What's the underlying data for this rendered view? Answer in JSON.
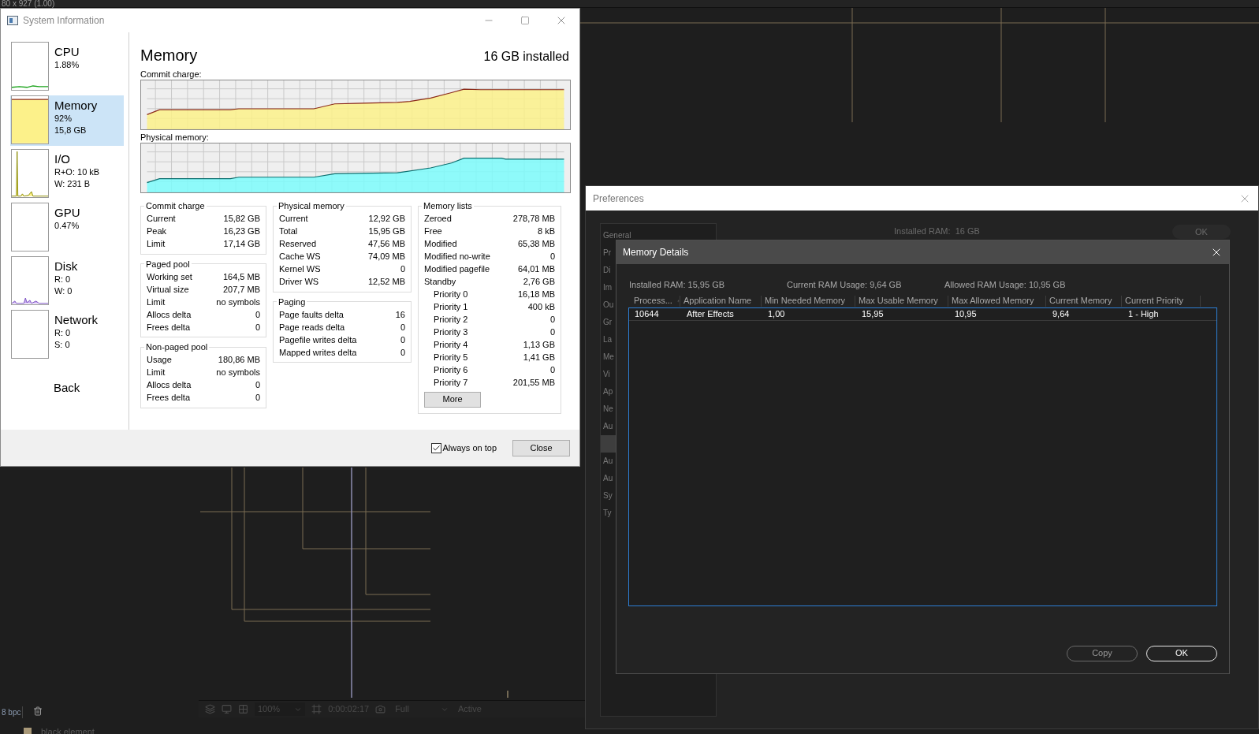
{
  "editor": {
    "resolution_label": "80 x 927 (1.00)",
    "bit_depth": "8 bpc",
    "layer_name": "black element",
    "viewer_toolbar": {
      "zoom": "100%",
      "timecode": "0:00:02:17",
      "resolution": "Full",
      "view": "Active"
    }
  },
  "system_info": {
    "title": "System Information",
    "sidebar": [
      {
        "title": "CPU",
        "lines": [
          "1.88%"
        ],
        "kind": "cpu",
        "selected": false
      },
      {
        "title": "Memory",
        "lines": [
          "92%",
          "15,8 GB"
        ],
        "kind": "memory",
        "selected": true
      },
      {
        "title": "I/O",
        "lines": [
          "R+O: 10 kB",
          "W: 231 B"
        ],
        "kind": "io",
        "selected": false
      },
      {
        "title": "GPU",
        "lines": [
          "0.47%"
        ],
        "kind": "empty",
        "selected": false
      },
      {
        "title": "Disk",
        "lines": [
          "R: 0",
          "W: 0"
        ],
        "kind": "disk",
        "selected": false
      },
      {
        "title": "Network",
        "lines": [
          "R: 0",
          "S: 0"
        ],
        "kind": "empty",
        "selected": false
      }
    ],
    "back": "Back",
    "heading": "Memory",
    "installed": "16 GB installed",
    "graphs": [
      {
        "label": "Commit charge:",
        "kind": "commit"
      },
      {
        "label": "Physical memory:",
        "kind": "physical"
      }
    ],
    "columns": [
      [
        {
          "title": "Commit charge",
          "rows": [
            {
              "label": "Current",
              "value": "15,82 GB"
            },
            {
              "label": "Peak",
              "value": "16,23 GB"
            },
            {
              "label": "Limit",
              "value": "17,14 GB"
            }
          ]
        },
        {
          "title": "Paged pool",
          "rows": [
            {
              "label": "Working set",
              "value": "164,5 MB"
            },
            {
              "label": "Virtual size",
              "value": "207,7 MB"
            },
            {
              "label": "Limit",
              "value": "no symbols"
            },
            {
              "label": "Allocs delta",
              "value": "0"
            },
            {
              "label": "Frees delta",
              "value": "0"
            }
          ]
        },
        {
          "title": "Non-paged pool",
          "rows": [
            {
              "label": "Usage",
              "value": "180,86 MB"
            },
            {
              "label": "Limit",
              "value": "no symbols"
            },
            {
              "label": "Allocs delta",
              "value": "0"
            },
            {
              "label": "Frees delta",
              "value": "0"
            }
          ]
        }
      ],
      [
        {
          "title": "Physical memory",
          "rows": [
            {
              "label": "Current",
              "value": "12,92 GB"
            },
            {
              "label": "Total",
              "value": "15,95 GB"
            },
            {
              "label": "Reserved",
              "value": "47,56 MB"
            },
            {
              "label": "Cache WS",
              "value": "74,09 MB"
            },
            {
              "label": "Kernel WS",
              "value": "0"
            },
            {
              "label": "Driver WS",
              "value": "12,52 MB"
            }
          ]
        },
        {
          "title": "Paging",
          "rows": [
            {
              "label": "Page faults delta",
              "value": "16"
            },
            {
              "label": "Page reads delta",
              "value": "0"
            },
            {
              "label": "Pagefile writes delta",
              "value": "0"
            },
            {
              "label": "Mapped writes delta",
              "value": "0"
            }
          ]
        }
      ],
      [
        {
          "title": "Memory lists",
          "button": "More",
          "rows": [
            {
              "label": "Zeroed",
              "value": "278,78 MB"
            },
            {
              "label": "Free",
              "value": "8 kB"
            },
            {
              "label": "Modified",
              "value": "65,38 MB"
            },
            {
              "label": "Modified no-write",
              "value": "0"
            },
            {
              "label": "Modified pagefile",
              "value": "64,01 MB"
            },
            {
              "label": "Standby",
              "value": "2,76 GB",
              "children": [
                {
                  "label": "Priority 0",
                  "value": "16,18 MB"
                },
                {
                  "label": "Priority 1",
                  "value": "400 kB"
                },
                {
                  "label": "Priority 2",
                  "value": "0"
                },
                {
                  "label": "Priority 3",
                  "value": "0"
                },
                {
                  "label": "Priority 4",
                  "value": "1,13 GB"
                },
                {
                  "label": "Priority 5",
                  "value": "1,41 GB"
                },
                {
                  "label": "Priority 6",
                  "value": "0"
                },
                {
                  "label": "Priority 7",
                  "value": "201,55 MB"
                }
              ]
            }
          ]
        }
      ]
    ],
    "always_on_top": {
      "label": "Always on top",
      "checked": true
    },
    "close": "Close"
  },
  "preferences": {
    "title": "Preferences",
    "background_label": "Installed RAM:  16 GB",
    "background_ok": "OK",
    "sidebar": [
      {
        "label": "General",
        "selected": false
      },
      {
        "label": "Pr",
        "selected": false
      },
      {
        "label": "Di",
        "selected": false
      },
      {
        "label": "Im",
        "selected": false
      },
      {
        "label": "Ou",
        "selected": false
      },
      {
        "label": "Gr",
        "selected": false
      },
      {
        "label": "La",
        "selected": false
      },
      {
        "label": "Me",
        "selected": false
      },
      {
        "label": "Vi",
        "selected": false
      },
      {
        "label": "Ap",
        "selected": false
      },
      {
        "label": "Ne",
        "selected": false
      },
      {
        "label": "Au",
        "selected": false
      },
      {
        "selected": true
      },
      {
        "label": "Au",
        "selected": false
      },
      {
        "label": "Au",
        "selected": false
      },
      {
        "label": "Sy",
        "selected": false
      },
      {
        "label": "Ty",
        "selected": false
      }
    ]
  },
  "memory_details": {
    "title": "Memory Details",
    "summary": [
      "Installed RAM: 15,95 GB",
      "Current RAM Usage: 9,64 GB",
      "Allowed RAM Usage: 10,95 GB"
    ],
    "columns": [
      {
        "label": "Process...",
        "sorted": true
      },
      {
        "label": "Application Name",
        "sorted": false
      },
      {
        "label": "Min Needed Memory",
        "sorted": false
      },
      {
        "label": "Max Usable Memory",
        "sorted": false
      },
      {
        "label": "Max Allowed Memory",
        "sorted": false
      },
      {
        "label": "Current Memory",
        "sorted": false
      },
      {
        "label": "Current Priority",
        "sorted": false
      }
    ],
    "rows": [
      {
        "cells": [
          "10644",
          "After Effects",
          "1,00",
          "15,95",
          "10,95",
          "9,64",
          "1 - High"
        ]
      }
    ],
    "buttons": [
      {
        "label": "Copy",
        "default": false
      },
      {
        "label": "OK",
        "default": true
      }
    ]
  }
}
